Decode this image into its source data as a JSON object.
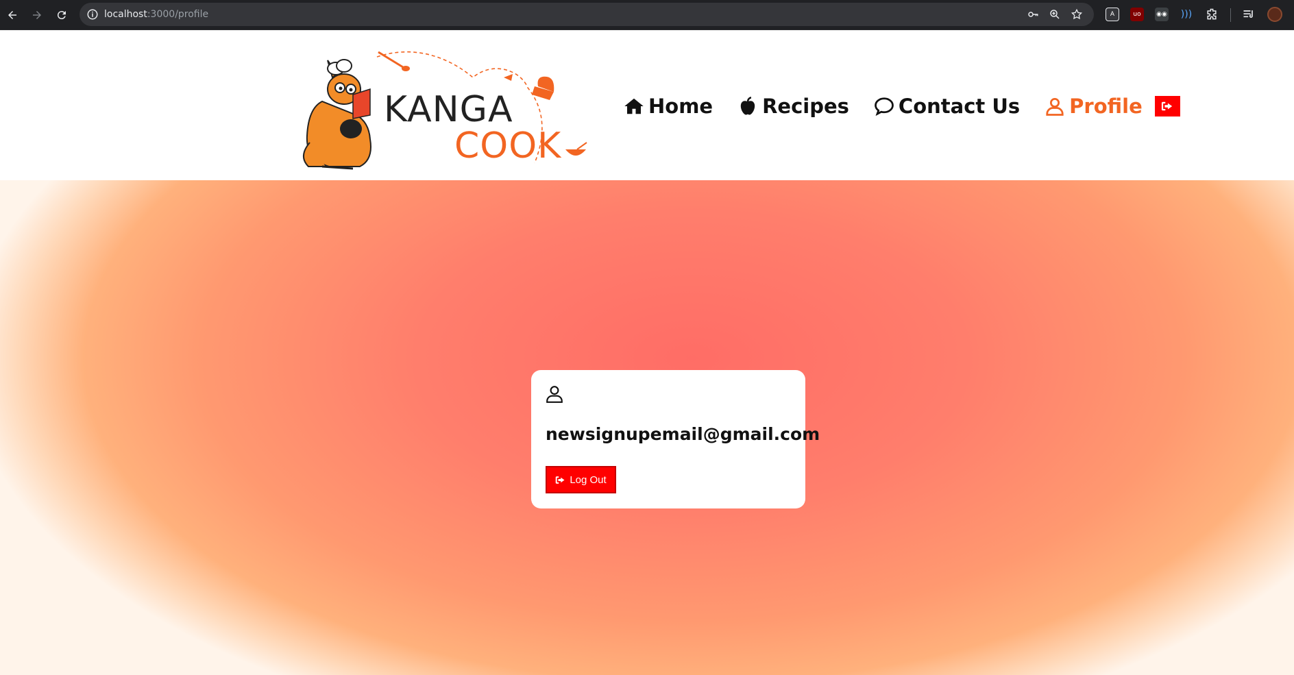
{
  "browser": {
    "url_host": "localhost",
    "url_path": ":3000/profile",
    "icons": {
      "back": "arrow-left-icon",
      "forward": "arrow-right-icon",
      "reload": "reload-icon",
      "site_info": "info-icon",
      "password": "key-icon",
      "zoom": "zoom-icon",
      "bookmark": "star-icon",
      "extensions": "puzzle-icon",
      "media": "media-control-icon",
      "profile": "profile-avatar-icon"
    }
  },
  "site": {
    "logo": {
      "line1": "KANGA",
      "line2": "COOK",
      "accent_color": "#f26522"
    },
    "nav": [
      {
        "label": "Home",
        "icon": "home-icon"
      },
      {
        "label": "Recipes",
        "icon": "apple-icon"
      },
      {
        "label": "Contact Us",
        "icon": "chat-bubble-icon"
      },
      {
        "label": "Profile",
        "icon": "user-icon",
        "active": true
      }
    ],
    "nav_logout_icon": "sign-out-icon",
    "active_color": "#f26522",
    "danger_color": "#ff0000"
  },
  "profile_card": {
    "icon": "user-icon",
    "email": "newsignupemail@gmail.com",
    "logout_label": "Log Out",
    "logout_icon": "sign-out-icon"
  }
}
